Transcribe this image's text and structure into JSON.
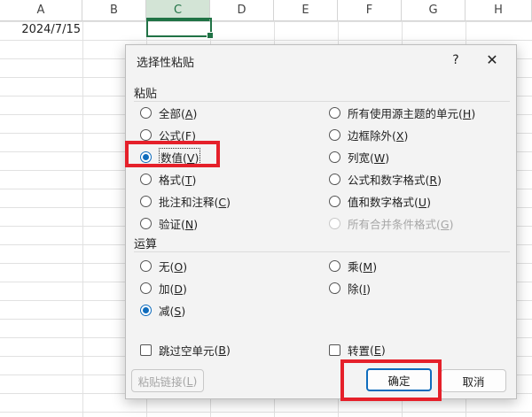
{
  "sheet": {
    "columns": [
      "A",
      "B",
      "C",
      "D",
      "E",
      "F",
      "G",
      "H"
    ],
    "selected_column": "C",
    "cell_a1": "2024/7/15"
  },
  "dialog": {
    "title": "选择性粘贴",
    "help": "?",
    "close": "✕",
    "paste_section": "粘贴",
    "paste_options_left": [
      {
        "label": "全部",
        "key": "A",
        "selected": false
      },
      {
        "label": "公式",
        "key": "F",
        "selected": false
      },
      {
        "label": "数值",
        "key": "V",
        "selected": true
      },
      {
        "label": "格式",
        "key": "T",
        "selected": false
      },
      {
        "label": "批注和注释",
        "key": "C",
        "selected": false
      },
      {
        "label": "验证",
        "key": "N",
        "selected": false
      }
    ],
    "paste_options_right": [
      {
        "label": "所有使用源主题的单元",
        "key": "H",
        "selected": false,
        "disabled": false
      },
      {
        "label": "边框除外",
        "key": "X",
        "selected": false,
        "disabled": false
      },
      {
        "label": "列宽",
        "key": "W",
        "selected": false,
        "disabled": false
      },
      {
        "label": "公式和数字格式",
        "key": "R",
        "selected": false,
        "disabled": false
      },
      {
        "label": "值和数字格式",
        "key": "U",
        "selected": false,
        "disabled": false
      },
      {
        "label": "所有合并条件格式",
        "key": "G",
        "selected": false,
        "disabled": true
      }
    ],
    "operation_section": "运算",
    "operation_left": [
      {
        "label": "无",
        "key": "O",
        "selected": false
      },
      {
        "label": "加",
        "key": "D",
        "selected": false
      },
      {
        "label": "减",
        "key": "S",
        "selected": true
      }
    ],
    "operation_right": [
      {
        "label": "乘",
        "key": "M",
        "selected": false
      },
      {
        "label": "除",
        "key": "I",
        "selected": false
      }
    ],
    "skip_blanks": {
      "label": "跳过空单元",
      "key": "B",
      "checked": false
    },
    "transpose": {
      "label": "转置",
      "key": "E",
      "checked": false
    },
    "paste_link_button": {
      "label": "粘贴链接",
      "key": "L"
    },
    "ok_button": "确定",
    "cancel_button": "取消"
  },
  "colors": {
    "accent": "#0f6cbd",
    "excel_green": "#217346",
    "highlight_red": "#e5202a"
  }
}
